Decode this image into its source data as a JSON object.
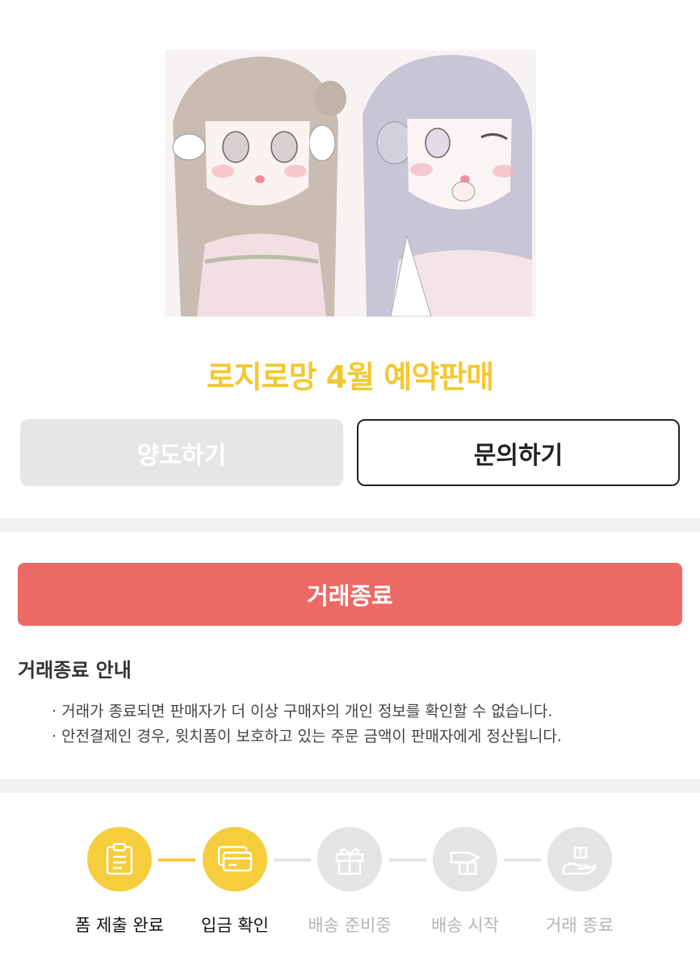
{
  "product": {
    "title": "로지로망 4월 예약판매",
    "image_alt": "illustration of two girls"
  },
  "actions": {
    "yangdo_label": "양도하기",
    "inquiry_label": "문의하기",
    "end_trade_label": "거래종료"
  },
  "guide": {
    "title": "거래종료 안내",
    "items": [
      "거래가 종료되면 판매자가 더 이상 구매자의 개인 정보를 확인할 수 없습니다.",
      "안전결제인 경우, 윗치폼이 보호하고 있는 주문 금액이 판매자에게 정산됩니다."
    ]
  },
  "progress": {
    "steps": [
      {
        "label": "폼 제출 완료",
        "icon": "clipboard-icon",
        "done": true
      },
      {
        "label": "입금 확인",
        "icon": "credit-card-icon",
        "done": true
      },
      {
        "label": "배송 준비중",
        "icon": "gift-box-icon",
        "done": false
      },
      {
        "label": "배송 시작",
        "icon": "rocket-box-icon",
        "done": false
      },
      {
        "label": "거래 종료",
        "icon": "hand-gift-icon",
        "done": false
      }
    ]
  },
  "colors": {
    "title_yellow": "#f3c832",
    "step_done": "#f5cd3d",
    "step_todo": "#e4e4e4",
    "end_button": "#ec6a65"
  }
}
